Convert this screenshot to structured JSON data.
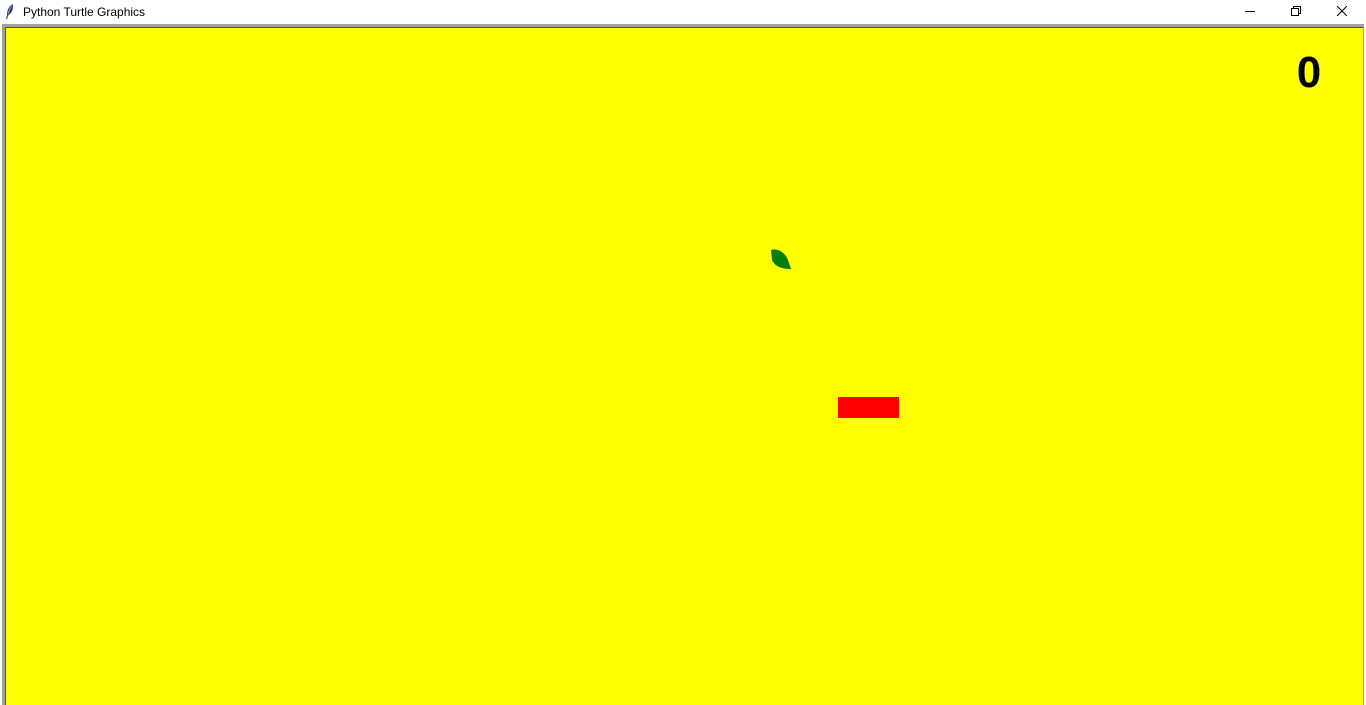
{
  "window": {
    "title": "Python Turtle Graphics"
  },
  "titlebar_buttons": {
    "minimize_icon": "minimize-icon",
    "restore_icon": "restore-icon",
    "close_icon": "close-icon"
  },
  "game": {
    "score": "0",
    "colors": {
      "background": "#ffff00",
      "snake": "#ff0000",
      "food": "#008000",
      "score_text": "#000000"
    }
  }
}
